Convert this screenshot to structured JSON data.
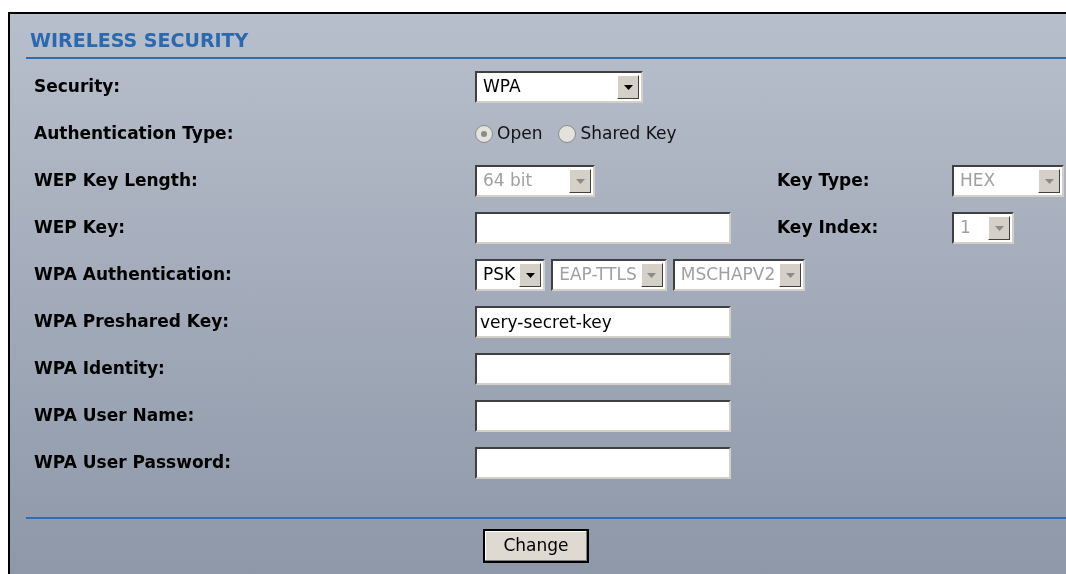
{
  "section_title": "WIRELESS SECURITY",
  "rows": [
    {
      "label": "Security:",
      "controls": [
        {
          "kind": "select",
          "value": "WPA",
          "disabled": false
        }
      ]
    },
    {
      "label": "Authentication Type:",
      "controls": [
        {
          "kind": "radio",
          "label": "Open",
          "selected": true,
          "disabled": true
        },
        {
          "kind": "radio",
          "label": "Shared Key",
          "selected": false,
          "disabled": true
        }
      ]
    },
    {
      "label": "WEP Key Length:",
      "controls": [
        {
          "kind": "select",
          "value": "64 bit",
          "disabled": true
        }
      ],
      "side": {
        "label": "Key Type:",
        "controls": [
          {
            "kind": "select",
            "value": "HEX",
            "disabled": true
          }
        ]
      }
    },
    {
      "label": "WEP Key:",
      "controls": [
        {
          "kind": "text"
        }
      ],
      "side": {
        "label": "Key Index:",
        "controls": [
          {
            "kind": "select",
            "value": "1",
            "disabled": true
          }
        ]
      }
    },
    {
      "label": "WPA Authentication:",
      "controls": [
        {
          "kind": "select",
          "value": "PSK",
          "disabled": false
        },
        {
          "kind": "select",
          "value": "EAP-TTLS",
          "disabled": true
        },
        {
          "kind": "select",
          "value": "MSCHAPV2",
          "disabled": true
        }
      ]
    },
    {
      "label": "WPA Preshared Key:",
      "controls": [
        {
          "kind": "text",
          "value": "very-secret-key"
        }
      ]
    },
    {
      "label": "WPA Identity:",
      "controls": [
        {
          "kind": "text"
        }
      ]
    },
    {
      "label": "WPA User Name:",
      "controls": [
        {
          "kind": "text"
        }
      ]
    },
    {
      "label": "WPA User Password:",
      "controls": [
        {
          "kind": "text"
        }
      ]
    }
  ],
  "button": "Change"
}
